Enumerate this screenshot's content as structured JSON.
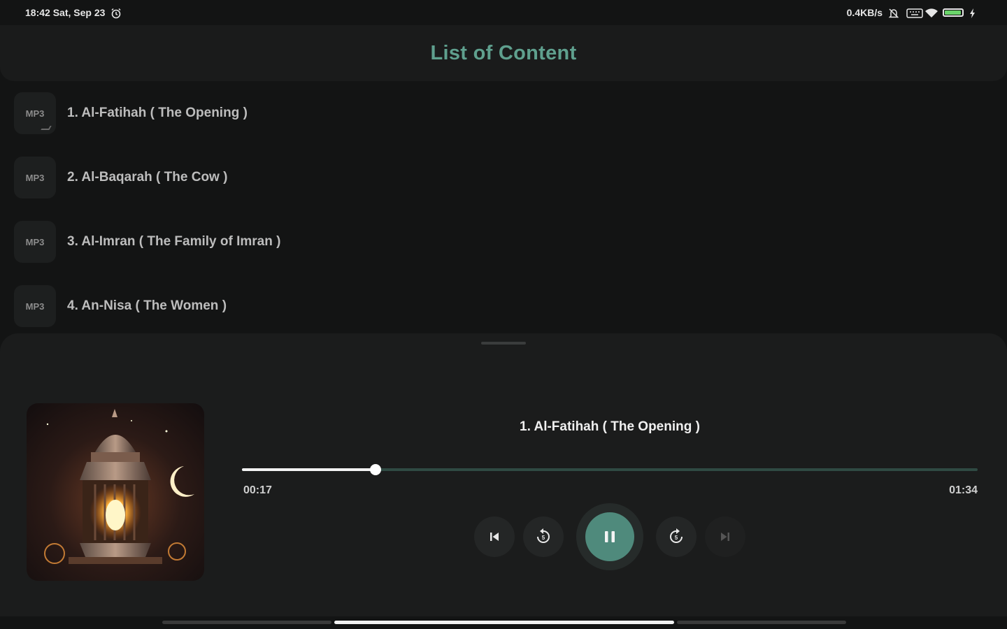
{
  "status_bar": {
    "time_date": "18:42 Sat, Sep 23",
    "network_speed": "0.4KB/s",
    "icons": [
      "alarm-icon",
      "mute-icon",
      "keyboard-icon",
      "wifi-icon",
      "battery-icon",
      "charging-icon"
    ],
    "battery_level": 0.95
  },
  "header": {
    "title": "List of Content"
  },
  "content": {
    "badge_label": "MP3",
    "items": [
      {
        "title": "1. Al-Fatihah ( The Opening )"
      },
      {
        "title": "2. Al-Baqarah ( The Cow )"
      },
      {
        "title": "3. Al-Imran ( The Family of Imran )"
      },
      {
        "title": "4. An-Nisa ( The Women )"
      }
    ]
  },
  "player": {
    "track_title": "1. Al-Fatihah ( The Opening )",
    "elapsed": "00:17",
    "total": "01:34",
    "progress": 0.182,
    "buttons": [
      "skip-previous-icon",
      "rewind-icon",
      "pause-icon",
      "forward-icon",
      "skip-next-icon"
    ]
  },
  "colors": {
    "accent": "#5fa08e",
    "play_button": "#4f8a7c",
    "progress_track": "#2f4a43"
  }
}
